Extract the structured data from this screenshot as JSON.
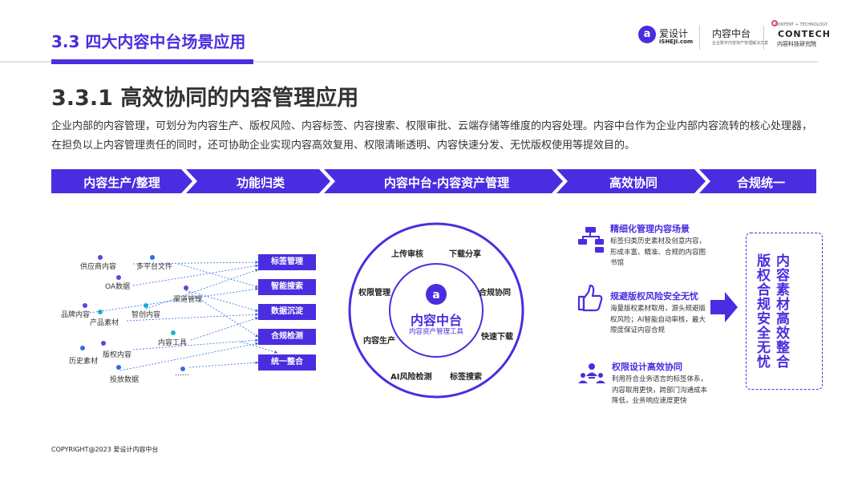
{
  "header": {
    "section_title": "3.3 四大内容中台场景应用",
    "logo_name": "爱设计",
    "logo_sub": "iSHEJI.com",
    "mid_name": "内容中台",
    "mid_sub": "企业数字内容资产管理解决方案",
    "contech_top": "CONTENT + TECHNOLOGY",
    "contech": "CONTECH",
    "contech_sub": "内容科技研究院"
  },
  "subtitle": "3.3.1 高效协同的内容管理应用",
  "paragraph": "企业内部的内容管理，可划分为内容生产、版权风险、内容标签、内容搜索、权限审批、云端存储等维度的内容处理。内容中台作为企业内部内容流转的核心处理器，在担负以上内容管理责任的同时，还可协助企业实现内容高效复用、权限清晰透明、内容快速分发、无忧版权使用等提效目的。",
  "steps": [
    "内容生产/整理",
    "功能归类",
    "内容中台-内容资产管理",
    "高效协同",
    "合规统一"
  ],
  "sources": {
    "supplier": "供应商内容",
    "multi_platform": "多平台文件",
    "oa": "OA数据",
    "channel": "渠道管理",
    "brand": "品牌内容",
    "product": "产品素材",
    "smart_creative": "智创内容",
    "content_tools": "内容工具",
    "history": "历史素材",
    "copyright": "版权内容",
    "ad_data": "投放数据",
    "ellipsis": "……"
  },
  "tags": [
    "标签管理",
    "智能搜索",
    "数据沉淀",
    "合规检测",
    "统一整合"
  ],
  "hub": {
    "title": "内容中台",
    "subtitle": "内容资产管理工具",
    "ring": [
      "上传审核",
      "下载分享",
      "权限管理",
      "合规协同",
      "内容生产",
      "快速下载",
      "AI风险检测",
      "标签搜索"
    ]
  },
  "benefits": [
    {
      "title": "精细化管理内容场景",
      "desc": "标签归类历史素材及创意内容，形成丰富、精准、合规的内容图书馆",
      "icon": "sitemap-icon"
    },
    {
      "title": "规避版权风险安全无忧",
      "desc": "海量版权素材取用，源头规避版权风险；AI智能自动审核，最大限度保证内容合规",
      "icon": "thumbs-up-icon"
    },
    {
      "title": "权限设计高效协同",
      "desc": "利用符合业务语言的标签体系，内容取用更快，跨部门沟通成本降低，业务响应速度更快",
      "icon": "team-icon"
    }
  ],
  "outcome": {
    "col1": "内容素材高效整合",
    "col2": "版权合规安全无忧"
  },
  "footer": "COPYRIGHT@2023 爱设计内容中台",
  "colors": {
    "accent": "#4a2de0",
    "dot_blue": "#2f6fe0",
    "dot_cyan": "#19b5d0",
    "dot_purple": "#6a3de0"
  }
}
